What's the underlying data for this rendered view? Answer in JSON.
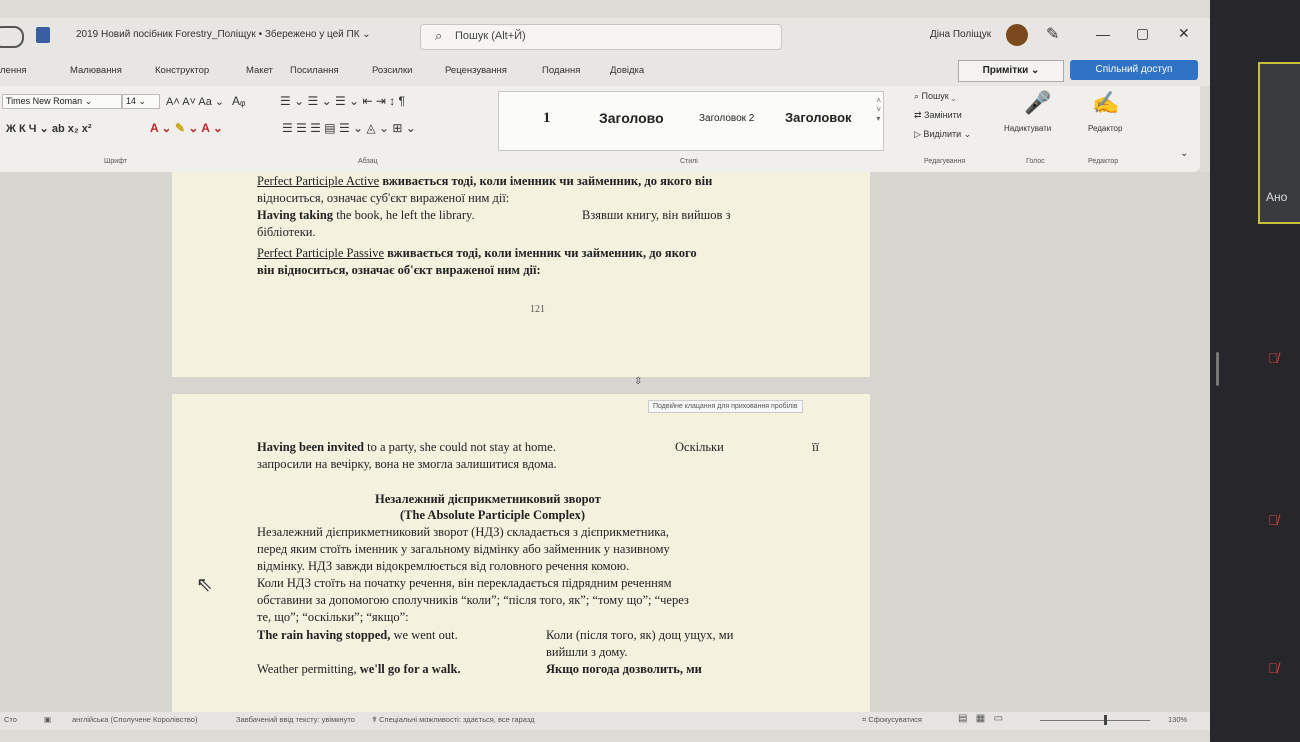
{
  "titlebar": {
    "doc_title": "2019 Новий посібник Forestry_Поліщук • Збережено у цей ПК ⌄",
    "search_placeholder": "Пошук (Alt+Й)",
    "user_name": "Діна Поліщук",
    "minimize": "—",
    "maximize": "▢",
    "close": "✕"
  },
  "menu": {
    "items": [
      "лення",
      "Малювання",
      "Конструктор",
      "Макет",
      "Посилання",
      "Розсилки",
      "Рецензування",
      "Подання",
      "Довідка"
    ],
    "notes_label": "Примітки ⌄",
    "share_label": "Спільний доступ"
  },
  "ribbon": {
    "font_name": "Times New Roman",
    "font_size": "14",
    "font_group_label": "Шрифт",
    "paragraph_group_label": "Абзац",
    "styles_group_label": "Стилі",
    "styles": [
      "1",
      "Заголово",
      "Заголовок 2",
      "Заголовок"
    ],
    "search_label": "Пошук",
    "replace_label": "Замінити",
    "select_label": "Виділити",
    "editing_group_label": "Редагування",
    "dictate_label": "Надиктувати",
    "voice_group_label": "Голос",
    "editor_label": "Редактор",
    "editor_group_label": "Редактор"
  },
  "page1": {
    "line1_a": "Perfect Participle Active",
    "line1_b": " вживається тоді, коли іменник чи займенник, до якого він",
    "line2": "відноситься, означає суб'єкт вираженої ним дії:",
    "line3_a": "Having taking",
    "line3_b": " the book, he left the library.",
    "line3_c": "Взявши  книгу,  він  вийшов  з",
    "line4": "бібліотеки.",
    "line5_a": "Perfect Participle Passive",
    "line5_b": " вживається тоді, коли іменник чи займенник, до якого",
    "line6": "він відноситься, означає об'єкт вираженої ним дії:",
    "page_number": "121"
  },
  "page2": {
    "tooltip": "Подвійне клацання для приховання пробілів",
    "l1_a": "Having been invited",
    "l1_b": " to a party, she could not stay at home.",
    "l1_c": "Оскільки",
    "l1_d": "її",
    "l2": "запросили на вечірку, вона не змогла залишитися вдома.",
    "h1": "Незалежний дієприкметниковий зворот",
    "h2": "(The Absolute Participle Complex)",
    "p1": "Незалежний дієприкметниковий зворот (НДЗ) складається з дієприкметника,",
    "p2": "перед яким стоїть іменник у загальному відмінку або займенник у називному",
    "p3": "відмінку. НДЗ завжди відокремлюється від головного речення комою.",
    "p4": "Коли НДЗ стоїть на початку речення, він перекладається підрядним реченням",
    "p5": "обставини за допомогою сполучників “коли”; “після того, як”; “тому що”; “через",
    "p6": "те, що”; “оскільки”; “якщо”:",
    "e1_a": "The rain having stopped,",
    "e1_b": " we went out.",
    "e1_c": "Коли (після того, як) дощ ущух, ми",
    "e1_d": "вийшли з дому.",
    "e2_a": "Weather permitting, ",
    "e2_b": "we'll go for a walk.",
    "e2_c": "Якщо погода дозволить, ми"
  },
  "statusbar": {
    "page": "Сто",
    "language": "англійська (Сполучене Королівство)",
    "prediction": "Завбачений ввід тексту: увімкнуто",
    "accessibility": "Спеціальні можливості: здається, все гаразд",
    "focus": "Сфокусуватися",
    "zoom": "130%"
  },
  "meeting": {
    "participant_label": "Ано"
  }
}
